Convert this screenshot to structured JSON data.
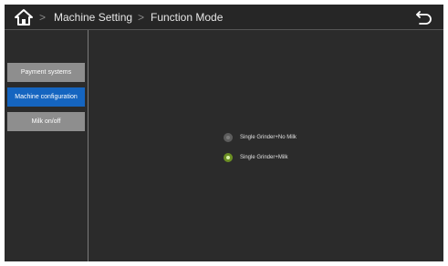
{
  "header": {
    "home_icon": "home-icon",
    "separator": ">",
    "breadcrumb": [
      "Machine Setting",
      "Function Mode"
    ],
    "back_icon": "return-arrow-icon"
  },
  "sidebar": {
    "items": [
      {
        "label": "Payment systems",
        "active": false
      },
      {
        "label": "Machine configuration",
        "active": true
      },
      {
        "label": "Milk on/off",
        "active": false
      }
    ]
  },
  "main": {
    "options": [
      {
        "label": "Single Grinder+No Milk",
        "selected": false
      },
      {
        "label": "Single Grinder+Milk",
        "selected": true
      }
    ]
  },
  "colors": {
    "background": "#2b2b2b",
    "active_item": "#1565c0",
    "inactive_item": "#8e8e8e",
    "selected_radio": "#6b8e23"
  }
}
